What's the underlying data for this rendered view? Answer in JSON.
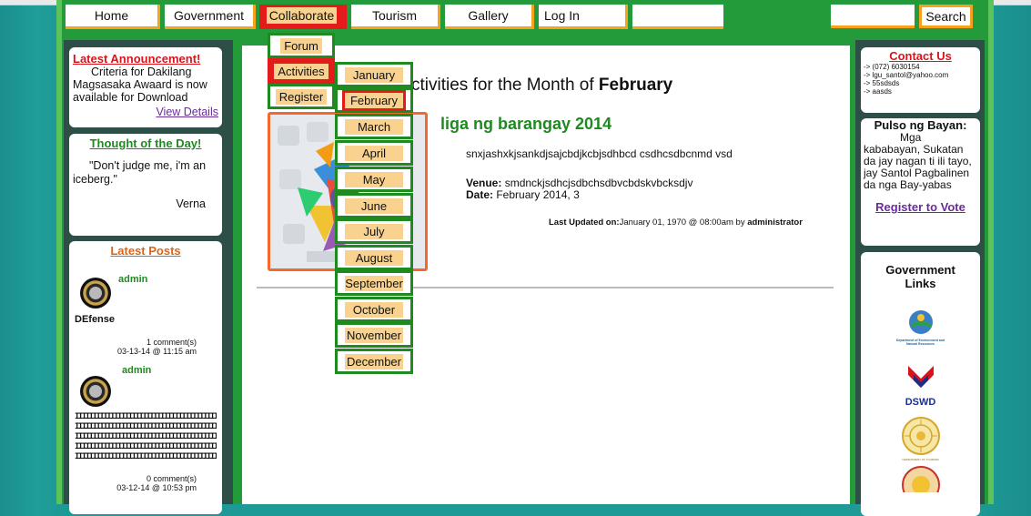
{
  "nav": {
    "items": [
      "Home",
      "Government",
      "Collaborate",
      "Tourism",
      "Gallery",
      "Log In"
    ],
    "active": "Collaborate",
    "search_button": "Search",
    "search_value": ""
  },
  "collaborate_menu": [
    "Forum",
    "Activities",
    "Register"
  ],
  "months_menu": [
    "January",
    "February",
    "March",
    "April",
    "May",
    "June",
    "July",
    "August",
    "September",
    "October",
    "November",
    "December"
  ],
  "announcement": {
    "title": "Latest Announcement!",
    "body": "Criteria for Dakilang Magsasaka Awaard is now available for Download",
    "link": "View Details"
  },
  "thought": {
    "title": "Thought of the Day!",
    "quote": "\"Don't judge me, i'm an iceberg.\"",
    "author": "Verna"
  },
  "latest_posts": {
    "title": "Latest Posts",
    "posts": [
      {
        "user": "admin",
        "title": "DEfense",
        "comments": "1 comment(s)",
        "date": "03-13-14 @ 11:15 am"
      },
      {
        "user": "admin",
        "title": "IIIIIIIIIIIIIIIIIIIIIIIIIIIIIIIIIIIIIIIIIIIIIIIII",
        "comments": "0 comment(s)",
        "date": "03-12-14 @ 10:53 pm"
      }
    ]
  },
  "main": {
    "page_heading_prefix": "ctivities for the Month of ",
    "page_heading_month": "February",
    "activity_title": "liga ng barangay 2014",
    "activity_desc": "snxjashxkjsankdjsajcbdjkcbjsdhbcd csdhcsdbcnmd vsd",
    "venue_label": "Venue:",
    "venue_value": " smdnckjsdhcjsdbchsdbvcbdskvbcksdjv",
    "date_label": "Date:",
    "date_value": " February 2014, 3",
    "updated_label": "Last Updated on:",
    "updated_value": "January 01, 1970 @ 08:00am by ",
    "updated_by": "administrator"
  },
  "contact": {
    "title": "Contact Us",
    "lines": [
      "-> (072) 6030154",
      "-> lgu_santol@yahoo.com",
      "-> 55sdsds",
      "-> aasds"
    ]
  },
  "pulso": {
    "title": "Pulso ng Bayan:",
    "body": "Mga kababayan, Sukatan da jay nagan ti ili tayo, jay Santol Pagbalinen da nga Bay-yabas",
    "link": "Register to Vote"
  },
  "gov_links": {
    "title": "Government Links",
    "denr_caption": "Department of Environment and Natural Resources",
    "dswd_caption": "DSWD",
    "dot_caption": "DEPARTMENT OF TOURISM"
  },
  "colors": {
    "nav_border": "#f6a21c",
    "active_red": "#e41b1b",
    "menu_green": "#1f8a1f",
    "label_tan": "#f8d28e"
  }
}
